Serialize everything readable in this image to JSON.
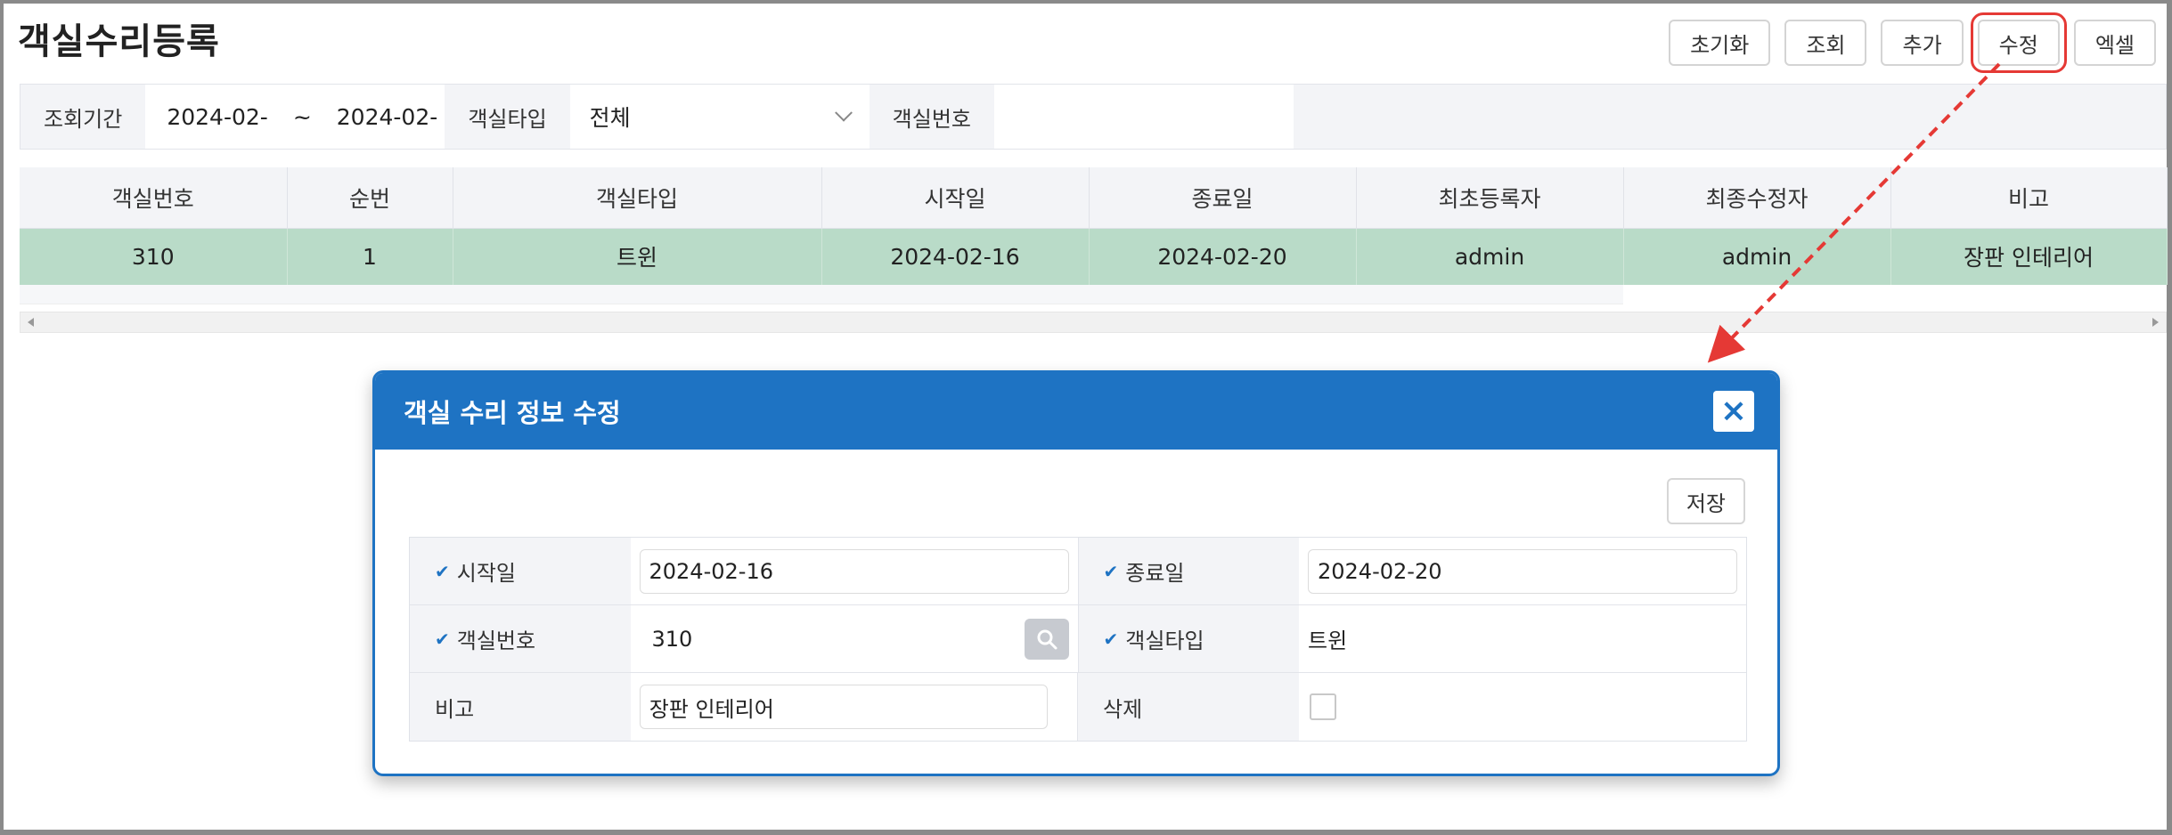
{
  "page": {
    "title": "객실수리등록"
  },
  "toolbar": {
    "reset": "초기화",
    "search": "조회",
    "add": "추가",
    "edit": "수정",
    "excel": "엑셀"
  },
  "search": {
    "period_label": "조회기간",
    "date_from": "2024-02-",
    "tilde": "~",
    "date_to": "2024-02-",
    "room_type_label": "객실타입",
    "room_type_value": "전체",
    "room_no_label": "객실번호",
    "room_no_value": ""
  },
  "grid": {
    "columns": [
      "객실번호",
      "순번",
      "객실타입",
      "시작일",
      "종료일",
      "최초등록자",
      "최종수정자",
      "비고"
    ],
    "rows": [
      [
        "310",
        "1",
        "트윈",
        "2024-02-16",
        "2024-02-20",
        "admin",
        "admin",
        "장판 인테리어"
      ]
    ]
  },
  "modal": {
    "title": "객실 수리 정보 수정",
    "close": "×",
    "save": "저장",
    "check": "✔",
    "fields": {
      "start_label": "시작일",
      "start_value": "2024-02-16",
      "end_label": "종료일",
      "end_value": "2024-02-20",
      "room_no_label": "객실번호",
      "room_no_value": "310",
      "room_type_label": "객실타입",
      "room_type_value": "트윈",
      "remark_label": "비고",
      "remark_value": "장판 인테리어",
      "delete_label": "삭제"
    }
  },
  "colors": {
    "accent": "#1e73c3",
    "selected_row": "#b9dbc8",
    "highlight": "#e53935"
  }
}
